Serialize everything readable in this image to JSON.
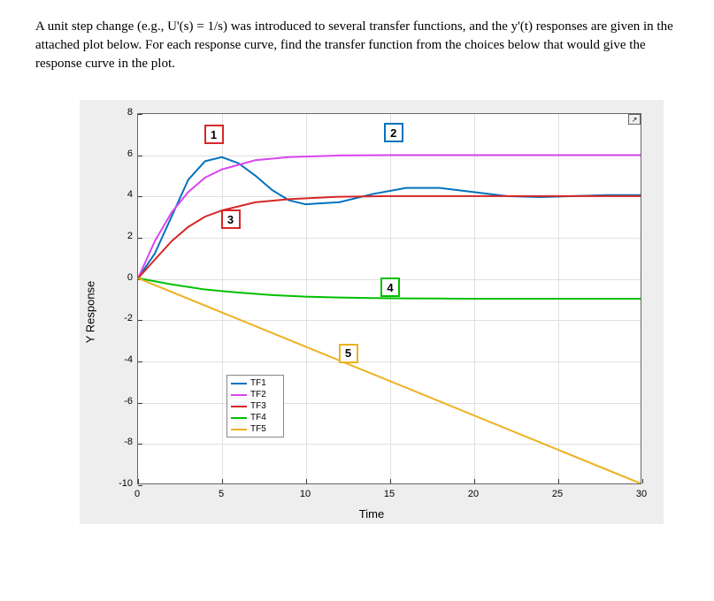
{
  "problem": {
    "text": "A unit step change (e.g., U'(s) = 1/s) was introduced to several transfer functions, and the y'(t) responses are given in the attached plot below.  For each response curve, find the transfer function from the choices below that would give the response curve in the plot."
  },
  "chart_data": {
    "type": "line",
    "title": "",
    "xlabel": "Time",
    "ylabel": "Y Response",
    "xlim": [
      0,
      30
    ],
    "ylim": [
      -10,
      8
    ],
    "x_ticks": [
      0,
      5,
      10,
      15,
      20,
      25,
      30
    ],
    "y_ticks": [
      -10,
      -8,
      -6,
      -4,
      -2,
      0,
      2,
      4,
      6,
      8
    ],
    "series": [
      {
        "name": "TF1",
        "color": "#0072BD",
        "label_num": "1",
        "x": [
          0,
          1,
          2,
          3,
          4,
          5,
          6,
          7,
          8,
          9,
          10,
          12,
          14,
          16,
          18,
          20,
          22,
          24,
          26,
          28,
          30
        ],
        "y": [
          0,
          1.2,
          3.0,
          4.8,
          5.7,
          5.9,
          5.6,
          5.0,
          4.3,
          3.8,
          3.6,
          3.7,
          4.1,
          4.4,
          4.4,
          4.2,
          4.0,
          3.95,
          4.0,
          4.05,
          4.05
        ]
      },
      {
        "name": "TF2",
        "color": "#D946EF",
        "label_num": "2",
        "x": [
          0,
          1,
          2,
          3,
          4,
          5,
          7,
          9,
          12,
          15,
          20,
          25,
          30
        ],
        "y": [
          0,
          1.8,
          3.2,
          4.2,
          4.9,
          5.3,
          5.75,
          5.9,
          5.98,
          6.0,
          6.0,
          6.0,
          6.0
        ]
      },
      {
        "name": "TF3",
        "color": "#D62728",
        "label_num": "3",
        "x": [
          0,
          1,
          2,
          3,
          4,
          5,
          7,
          9,
          12,
          15,
          20,
          25,
          30
        ],
        "y": [
          0,
          0.9,
          1.8,
          2.5,
          3.0,
          3.3,
          3.7,
          3.85,
          3.97,
          4.0,
          4.0,
          4.0,
          4.0
        ]
      },
      {
        "name": "TF4",
        "color": "#00C000",
        "label_num": "4",
        "x": [
          0,
          2,
          4,
          6,
          8,
          10,
          12,
          14,
          16,
          18,
          20,
          25,
          30
        ],
        "y": [
          0,
          -0.3,
          -0.55,
          -0.7,
          -0.82,
          -0.9,
          -0.94,
          -0.97,
          -0.985,
          -0.99,
          -1.0,
          -1.0,
          -1.0
        ]
      },
      {
        "name": "TF5",
        "color": "#EDB120",
        "label_num": "5",
        "x": [
          0,
          30
        ],
        "y": [
          0,
          -10
        ]
      }
    ],
    "labels": [
      {
        "num": "1",
        "x": 4.5,
        "y": 7.0,
        "color": "#D62728"
      },
      {
        "num": "2",
        "x": 15.2,
        "y": 7.1,
        "color": "#0072BD"
      },
      {
        "num": "3",
        "x": 5.5,
        "y": 2.9,
        "color": "#D62728"
      },
      {
        "num": "4",
        "x": 15.0,
        "y": -0.4,
        "color": "#00C000"
      },
      {
        "num": "5",
        "x": 12.5,
        "y": -3.6,
        "color": "#EDB120"
      }
    ],
    "legend_position": {
      "x": 3.0,
      "y": -4.0
    }
  }
}
